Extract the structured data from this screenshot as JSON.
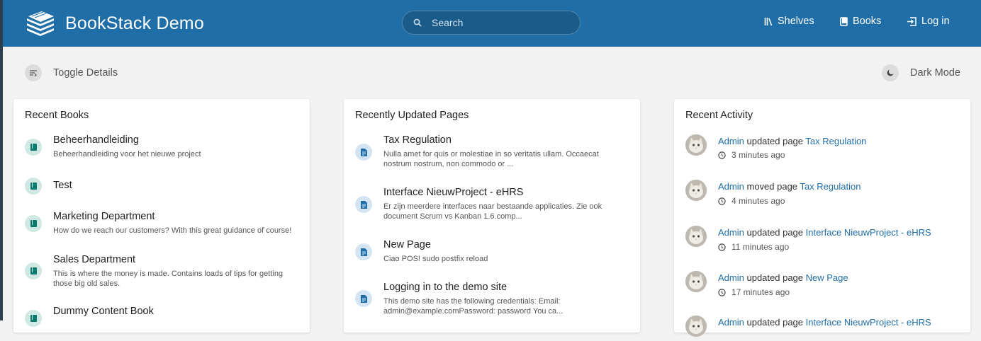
{
  "header": {
    "app_title": "BookStack Demo",
    "search_placeholder": "Search",
    "nav": [
      {
        "label": "Shelves",
        "icon": "shelves-icon"
      },
      {
        "label": "Books",
        "icon": "books-icon"
      },
      {
        "label": "Log in",
        "icon": "login-icon"
      }
    ]
  },
  "toolbar": {
    "toggle_details": "Toggle Details",
    "dark_mode": "Dark Mode"
  },
  "recent_books": {
    "title": "Recent Books",
    "items": [
      {
        "name": "Beheerhandleiding",
        "desc": "Beheerhandleiding voor het nieuwe project"
      },
      {
        "name": "Test",
        "desc": ""
      },
      {
        "name": "Marketing Department",
        "desc": "How do we reach our customers? With this great guidance of course!"
      },
      {
        "name": "Sales Department",
        "desc": "This is where the money is made. Contains loads of tips for getting those big old sales."
      },
      {
        "name": "Dummy Content Book",
        "desc": ""
      }
    ]
  },
  "recent_pages": {
    "title": "Recently Updated Pages",
    "items": [
      {
        "name": "Tax Regulation",
        "desc": "Nulla amet for quis or molestiae in so veritatis ullam. Occaecat nostrum nostrum, non commodo or ..."
      },
      {
        "name": "Interface NieuwProject - eHRS",
        "desc": "Er zijn meerdere interfaces naar bestaande applicaties. Zie ook document Scrum vs Kanban 1.6.comp..."
      },
      {
        "name": "New Page",
        "desc": "Ciao POS! sudo postfix reload"
      },
      {
        "name": "Logging in to the demo site",
        "desc": "This demo site has the following credentials: Email: admin@example.comPassword: password You ca..."
      }
    ]
  },
  "recent_activity": {
    "title": "Recent Activity",
    "items": [
      {
        "user": "Admin",
        "action": "updated page",
        "target": "Tax Regulation",
        "time": "3 minutes ago"
      },
      {
        "user": "Admin",
        "action": "moved page",
        "target": "Tax Regulation",
        "time": "4 minutes ago"
      },
      {
        "user": "Admin",
        "action": "updated page",
        "target": "Interface NieuwProject - eHRS",
        "time": "11 minutes ago"
      },
      {
        "user": "Admin",
        "action": "updated page",
        "target": "New Page",
        "time": "17 minutes ago"
      },
      {
        "user": "Admin",
        "action": "updated page",
        "target": "Interface NieuwProject - eHRS",
        "time": ""
      }
    ]
  },
  "colors": {
    "header_bg": "#206ea7",
    "link": "#206ea7",
    "book_icon": "#077b70",
    "page_icon": "#206ea7"
  }
}
